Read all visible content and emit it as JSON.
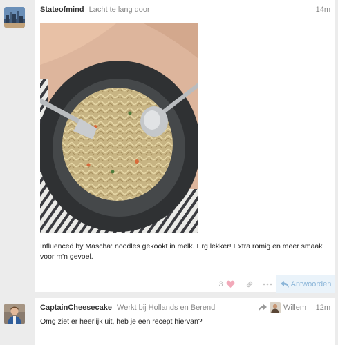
{
  "posts": [
    {
      "username": "Stateofmind",
      "user_title": "Lacht te lang door",
      "time": "14m",
      "text": "Influenced by Mascha: noodles gekookt in melk. Erg lekker! Extra romig en meer smaak voor m'n gevoel.",
      "like_count": "3",
      "reply_label": "Antwoorden",
      "avatar_icon": "city-skyline-avatar",
      "photo": "bowl-of-noodles-photo"
    },
    {
      "username": "CaptainCheesecake",
      "user_title": "Werkt bij Hollands en Berend",
      "time": "12m",
      "reply_to_user": "Willem",
      "text": "Omg ziet er heerlijk uit, heb je een recept hiervan?",
      "avatar_icon": "person-avatar"
    }
  ],
  "colors": {
    "heart": "#e45a7a",
    "reply_bg": "#eaf3fa",
    "reply_text": "#8cb6d9",
    "page_bg": "#ececec"
  }
}
